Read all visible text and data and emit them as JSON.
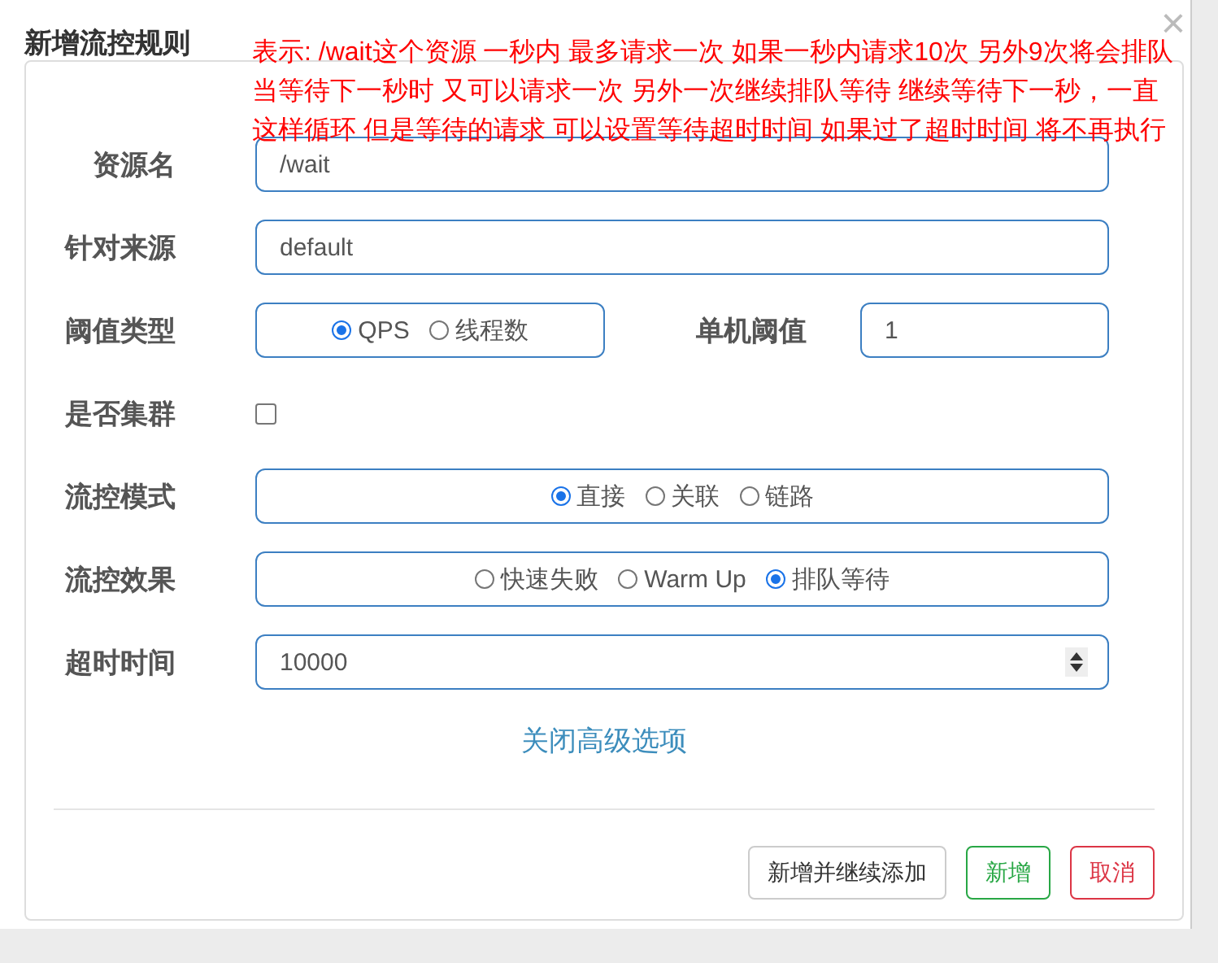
{
  "dialog": {
    "title": "新增流控规则",
    "close": "×"
  },
  "annotation": "表示: /wait这个资源 一秒内 最多请求一次  如果一秒内请求10次 另外9次将会排队当等待下一秒时 又可以请求一次  另外一次继续排队等待 继续等待下一秒，一直这样循环   但是等待的请求 可以设置等待超时时间 如果过了超时时间 将不再执行",
  "rows": [
    {
      "kind": "text",
      "label": "资源名",
      "value": "/wait"
    },
    {
      "kind": "text",
      "label": "针对来源",
      "value": "default"
    },
    {
      "kind": "split",
      "label": "阈值类型",
      "options": [
        {
          "label": "QPS",
          "selected": true
        },
        {
          "label": "线程数",
          "selected": false
        }
      ],
      "label_2": "单机阈值",
      "value_2": "1"
    },
    {
      "kind": "checkbox",
      "label": "是否集群",
      "checked": false
    },
    {
      "kind": "radio",
      "label": "流控模式",
      "options": [
        {
          "label": "直接",
          "selected": true
        },
        {
          "label": "关联",
          "selected": false
        },
        {
          "label": "链路",
          "selected": false
        }
      ]
    },
    {
      "kind": "radio",
      "label": "流控效果",
      "options": [
        {
          "label": "快速失败",
          "selected": false
        },
        {
          "label": "Warm Up",
          "selected": false
        },
        {
          "label": "排队等待",
          "selected": true
        }
      ]
    },
    {
      "kind": "number",
      "label": "超时时间",
      "value": "10000"
    }
  ],
  "advanced_link": "关闭高级选项",
  "buttons": [
    {
      "label": "新增并继续添加",
      "kind": "default"
    },
    {
      "label": "新增",
      "kind": "success"
    },
    {
      "label": "取消",
      "kind": "danger"
    }
  ]
}
